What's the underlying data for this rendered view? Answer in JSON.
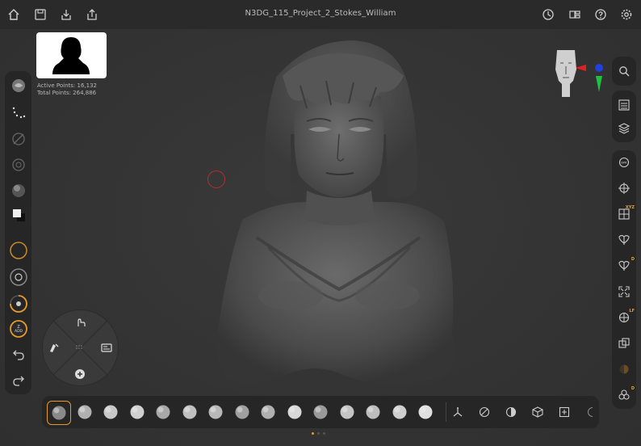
{
  "topbar": {
    "title": "N3DG_115_Project_2_Stokes_William",
    "left_icons": [
      "home-icon",
      "save-icon",
      "import-icon",
      "share-icon"
    ],
    "right_icons": [
      "history-icon",
      "layout-icon",
      "help-icon",
      "settings-icon"
    ]
  },
  "stats": {
    "active_points_label": "Active Points: 16,132",
    "total_points_label": "Total Points: 264,886"
  },
  "left_toolbar": {
    "items": [
      "brush-sphere-icon",
      "stroke-dots-icon",
      "lazy-mouse-icon",
      "snap-icon",
      "material-icon",
      "color-swatch-icon",
      "draw-size-ring",
      "focal-shift-ring",
      "intensity-ring",
      "z-add-ring",
      "undo-icon",
      "redo-icon"
    ],
    "z_add_label": "Z ADD",
    "z_add_z": "Z",
    "z_add_text": "ADD"
  },
  "right_toolbar": {
    "top_group": [
      "search-icon"
    ],
    "group2": [
      "list-icon",
      "layers-icon"
    ],
    "group3": [
      "bpr-icon",
      "grid-target-icon",
      "xyz-grid-icon",
      "symmetry-icon",
      "symmetry-d-icon",
      "fit-icon",
      "lf-sphere-icon",
      "transparency-icon",
      "polyframe-icon",
      "dynamesh-icon"
    ],
    "badges": {
      "xyz": "XYZ",
      "d": "D",
      "lf": "LF",
      "d2": "D"
    }
  },
  "bottom_toolbar": {
    "brushes": [
      "standard-brush",
      "clay-brush",
      "claybuildup-brush",
      "move-brush",
      "damstandard-brush",
      "inflate-brush",
      "pinch-brush",
      "trimdynamic-brush",
      "hpolish-brush",
      "smooth-brush",
      "snakehook-brush",
      "flatten-brush",
      "planar-brush",
      "curve-brush",
      "spiral-brush"
    ],
    "tools": [
      "gizmo-icon",
      "mask-icon",
      "contrast-icon",
      "cube-icon",
      "add-box-icon",
      "moon-icon"
    ]
  },
  "radial_menu": {
    "items": [
      "pointer-hand-icon",
      "smudge-icon",
      "gallery-icon",
      "add-plus-icon",
      "center-grid-icon"
    ]
  },
  "pager": {
    "active_index": 0,
    "count": 3
  }
}
